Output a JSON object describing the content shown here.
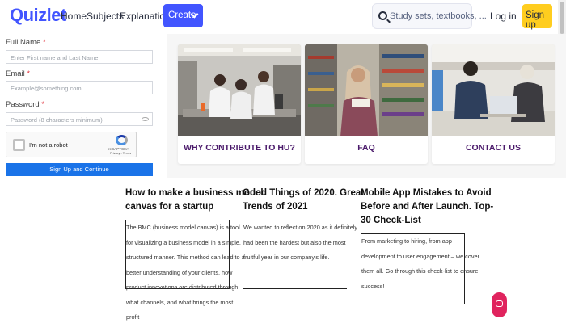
{
  "header": {
    "logo": "Quizlet",
    "nav": [
      "Home",
      "Subjects",
      "Explanations"
    ],
    "create_label": "Create",
    "search_placeholder": "Study sets, textbooks, ...",
    "login_label": "Log in",
    "signup_label": "Sign up"
  },
  "form": {
    "name_label": "Full Name",
    "name_placeholder": "Enter First name and Last Name",
    "email_label": "Email",
    "email_placeholder": "Example@something.com",
    "password_label": "Password",
    "password_placeholder": "Password (8 characters minimum)",
    "required_mark": "*",
    "recaptcha_label": "I'm not a robot",
    "recaptcha_brand": "reCAPTCHA",
    "recaptcha_terms": "Privacy - Terms",
    "submit_label": "Sign Up and Continue"
  },
  "cards": [
    {
      "caption": "WHY CONTRIBUTE TO HU?"
    },
    {
      "caption": "FAQ"
    },
    {
      "caption": "CONTACT US"
    }
  ],
  "articles": [
    {
      "title_lines": [
        "How to make a business model",
        "canvas for a startup"
      ],
      "excerpt_lines": [
        "The BMC (business model canvas) is a tool",
        "for visualizing a business model in a simple,",
        "structured manner. This method can lead to a",
        "better understanding of your clients, how",
        "product innovations are distributed through",
        "what channels, and what brings the most",
        "profit"
      ]
    },
    {
      "title_lines": [
        "Good Things of 2020. Great",
        "Trends of 2021"
      ],
      "excerpt_lines": [
        "We wanted to reflect on 2020 as it definitely",
        "had been the hardest but also the most",
        "fruitful year in our company's life."
      ]
    },
    {
      "title_lines": [
        "Mobile App Mistakes to Avoid",
        "Before and After Launch. Top-",
        "30 Check-List"
      ],
      "excerpt_lines": [
        "From marketing to hiring, from app",
        "development to user engagement – we cover",
        "them all. Go through this check-list to ensure",
        "success!"
      ]
    }
  ],
  "colors": {
    "brand": "#4255ff",
    "signup": "#ffcd1f",
    "caption": "#4b1a6b",
    "submit": "#1a73e8",
    "chat": "#e0245e"
  }
}
